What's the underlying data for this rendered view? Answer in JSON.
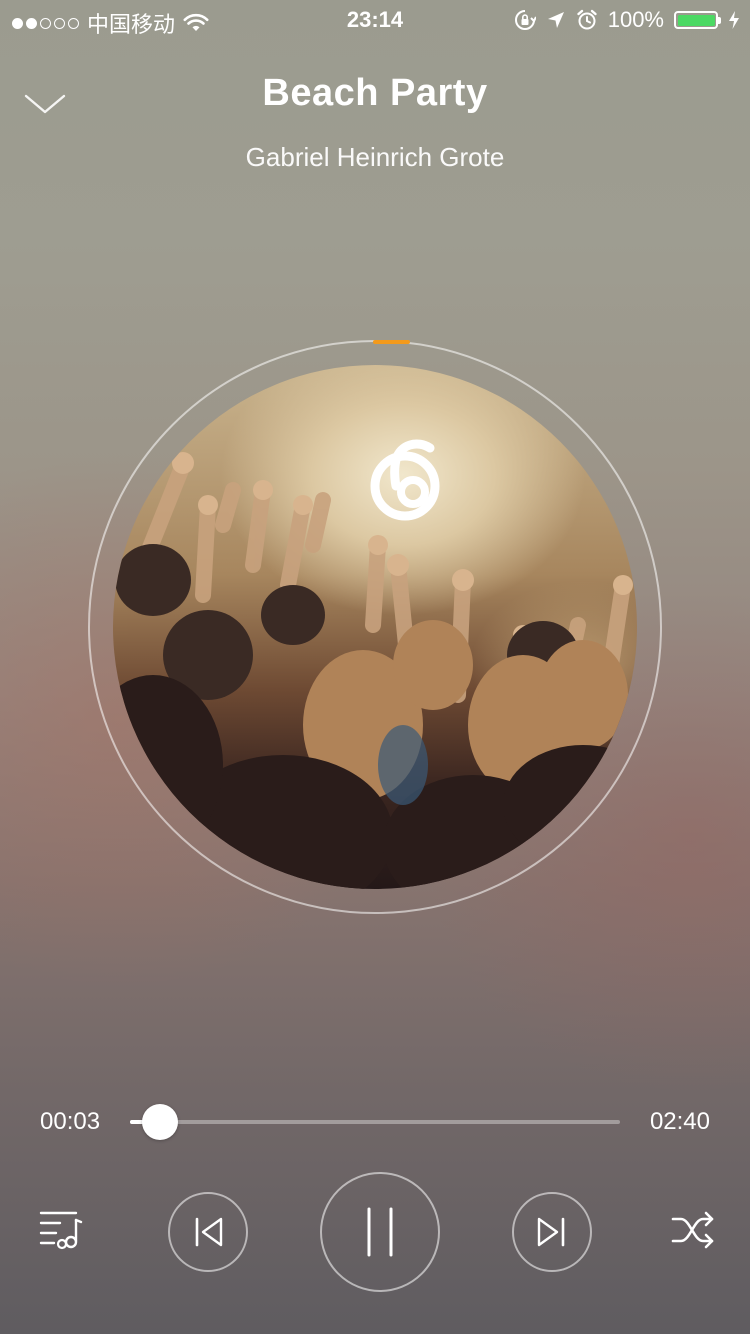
{
  "status_bar": {
    "carrier": "中国移动",
    "time": "23:14",
    "battery_percent": "100%",
    "battery_level": 1.0,
    "battery_color": "#4cd964",
    "icons": [
      "signal-dots-icon",
      "wifi-icon",
      "rotation-lock-icon",
      "location-arrow-icon",
      "alarm-clock-icon",
      "battery-icon",
      "charging-bolt-icon"
    ]
  },
  "header": {
    "title": "Beach Party",
    "artist": "Gabriel Heinrich Grote",
    "collapse_icon": "chevron-down-icon"
  },
  "artwork": {
    "logo_icon": "music-note-logo-icon",
    "ring_accent_color": "#f39a1c"
  },
  "player": {
    "current_time": "00:03",
    "total_time": "02:40",
    "progress": 0.02
  },
  "controls": {
    "playlist_icon": "playlist-icon",
    "previous_icon": "previous-track-icon",
    "pause_icon": "pause-icon",
    "next_icon": "next-track-icon",
    "shuffle_icon": "shuffle-icon"
  }
}
